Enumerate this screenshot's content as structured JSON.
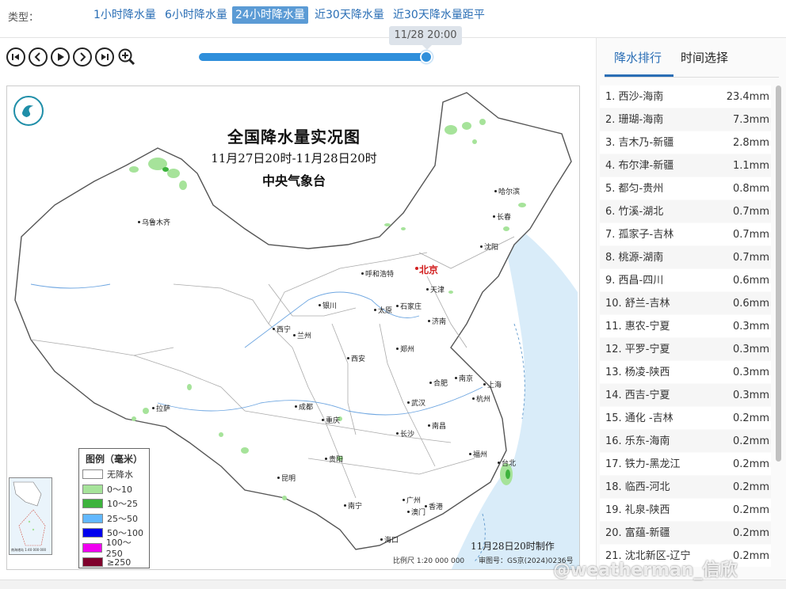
{
  "typebar": {
    "label": "类型：",
    "tabs": [
      {
        "label": "1小时降水量"
      },
      {
        "label": "6小时降水量"
      },
      {
        "label": "24小时降水量",
        "active": true
      },
      {
        "label": "近30天降水量"
      },
      {
        "label": "近30天降水量距平"
      }
    ]
  },
  "player": {
    "current_time": "11/28 20:00",
    "progress": 1.0,
    "buttons": [
      "skip-first-icon",
      "prev-icon",
      "play-icon",
      "next-icon",
      "skip-last-icon",
      "zoom-in-icon"
    ]
  },
  "map": {
    "title": "全国降水量实况图",
    "period": "11月27日20时-11月28日20时",
    "issuer": "中央气象台",
    "made_time": "11月28日20时制作",
    "scale": "比例尺 1:20 000 000",
    "approval": "审图号：GS京(2024)0236号",
    "inset_caption": "南海诸岛 1:40 000 000",
    "legend": {
      "title": "图例（毫米）",
      "items": [
        {
          "label": "无降水",
          "color": "#ffffff"
        },
        {
          "label": "0～10",
          "color": "#a6e39a"
        },
        {
          "label": "10～25",
          "color": "#3db33d"
        },
        {
          "label": "25～50",
          "color": "#62b8ff"
        },
        {
          "label": "50～100",
          "color": "#0000ee"
        },
        {
          "label": "100～250",
          "color": "#f000f0"
        },
        {
          "label": "≥250",
          "color": "#80002c"
        }
      ]
    },
    "cities": {
      "wulumuqi": "乌鲁木齐",
      "haerbin": "哈尔滨",
      "changchun": "长春",
      "shenyang": "沈阳",
      "huhehaote": "呼和浩特",
      "beijing": "北京",
      "tianjin": "天津",
      "yinchuan": "银川",
      "taiyuan": "太原",
      "shijiazhuang": "石家庄",
      "jinan": "济南",
      "xining": "西宁",
      "lanzhou": "兰州",
      "zhengzhou": "郑州",
      "xian": "西安",
      "hefei": "合肥",
      "nanjing": "南京",
      "shanghai": "上海",
      "lasa": "拉萨",
      "chengdu": "成都",
      "wuhan": "武汉",
      "hangzhou": "杭州",
      "chongqing": "重庆",
      "nanchang": "南昌",
      "changsha": "长沙",
      "guiyang": "贵阳",
      "fuzhou": "福州",
      "taibei": "台北",
      "kunming": "昆明",
      "nanning": "南宁",
      "guangzhou": "广州",
      "xianggang": "香港",
      "aomen": "澳门",
      "haikou": "海口"
    }
  },
  "rank_panel": {
    "tabs": [
      {
        "label": "降水排行",
        "active": true
      },
      {
        "label": "时间选择"
      }
    ],
    "items": [
      {
        "name": "1. 西沙-海南",
        "value": "23.4mm"
      },
      {
        "name": "2. 珊瑚-海南",
        "value": "7.3mm"
      },
      {
        "name": "3. 吉木乃-新疆",
        "value": "2.8mm"
      },
      {
        "name": "4. 布尔津-新疆",
        "value": "1.1mm"
      },
      {
        "name": "5. 都匀-贵州",
        "value": "0.8mm"
      },
      {
        "name": "6. 竹溪-湖北",
        "value": "0.7mm"
      },
      {
        "name": "7. 孤家子-吉林",
        "value": "0.7mm"
      },
      {
        "name": "8. 桃源-湖南",
        "value": "0.7mm"
      },
      {
        "name": "9. 西昌-四川",
        "value": "0.6mm"
      },
      {
        "name": "10. 舒兰-吉林",
        "value": "0.6mm"
      },
      {
        "name": "11. 惠农-宁夏",
        "value": "0.3mm"
      },
      {
        "name": "12. 平罗-宁夏",
        "value": "0.3mm"
      },
      {
        "name": "13. 杨凌-陕西",
        "value": "0.3mm"
      },
      {
        "name": "14. 西吉-宁夏",
        "value": "0.3mm"
      },
      {
        "name": "15. 通化 -吉林",
        "value": "0.2mm"
      },
      {
        "name": "16. 乐东-海南",
        "value": "0.2mm"
      },
      {
        "name": "17. 铁力-黑龙江",
        "value": "0.2mm"
      },
      {
        "name": "18. 临西-河北",
        "value": "0.2mm"
      },
      {
        "name": "19. 礼泉-陕西",
        "value": "0.2mm"
      },
      {
        "name": "20. 富蕴-新疆",
        "value": "0.2mm"
      },
      {
        "name": "21. 沈北新区-辽宁",
        "value": "0.2mm"
      }
    ]
  },
  "watermark": "@weatherman_信欣"
}
